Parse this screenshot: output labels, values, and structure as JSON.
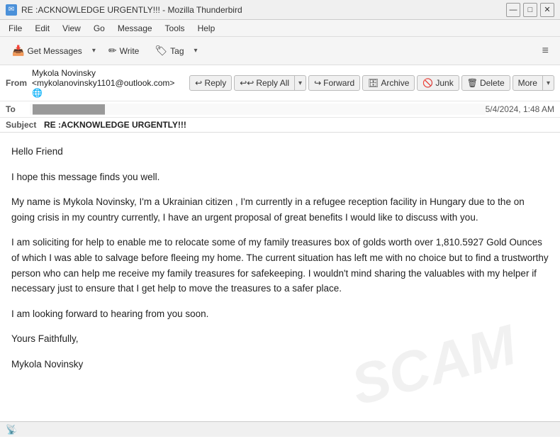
{
  "window": {
    "title": "RE :ACKNOWLEDGE URGENTLY!!! - Mozilla Thunderbird",
    "icon": "✉"
  },
  "titlebar": {
    "minimize": "—",
    "maximize": "□",
    "close": "✕"
  },
  "menubar": {
    "items": [
      "File",
      "Edit",
      "View",
      "Go",
      "Message",
      "Tools",
      "Help"
    ]
  },
  "toolbar": {
    "get_messages_label": "Get Messages",
    "write_label": "Write",
    "tag_label": "Tag",
    "hamburger": "≡"
  },
  "email_header": {
    "from_label": "From",
    "from_name": "Mykola Novinsky",
    "from_email": "<mykolanovinsky1101@outlook.com>",
    "globe_icon": "🌐",
    "reply_label": "Reply",
    "reply_all_label": "Reply All",
    "forward_label": "Forward",
    "archive_label": "Archive",
    "junk_label": "Junk",
    "delete_label": "Delete",
    "more_label": "More",
    "to_label": "To",
    "to_value": "████████████",
    "date": "5/4/2024, 1:48 AM",
    "subject_label": "Subject",
    "subject_value": "RE :ACKNOWLEDGE URGENTLY!!!"
  },
  "email_body": {
    "greeting": "Hello  Friend",
    "para1": "I hope this message finds you well.",
    "para2": "My name is Mykola Novinsky, I'm a Ukrainian citizen , I'm currently in a refugee reception facility in Hungary due to the on going crisis in my country currently, I have an urgent proposal of great benefits I would like to discuss with you.",
    "para3": "I am soliciting for help to enable me to relocate some of my family treasures box of golds worth over 1,810.5927 Gold Ounces of  which I was able to salvage before fleeing my home. The current situation has left me with no choice but to find a trustworthy person who can help me receive my family treasures for safekeeping. I wouldn't mind sharing the valuables with my helper if necessary just to ensure that I get help to move the treasures to a safer place.",
    "para4": "I am looking forward to hearing from you soon.",
    "sign1": "Yours Faithfully,",
    "sign2": "Mykola Novinsky",
    "watermark": "SCAM"
  },
  "statusbar": {
    "icon": "📡",
    "text": ""
  }
}
